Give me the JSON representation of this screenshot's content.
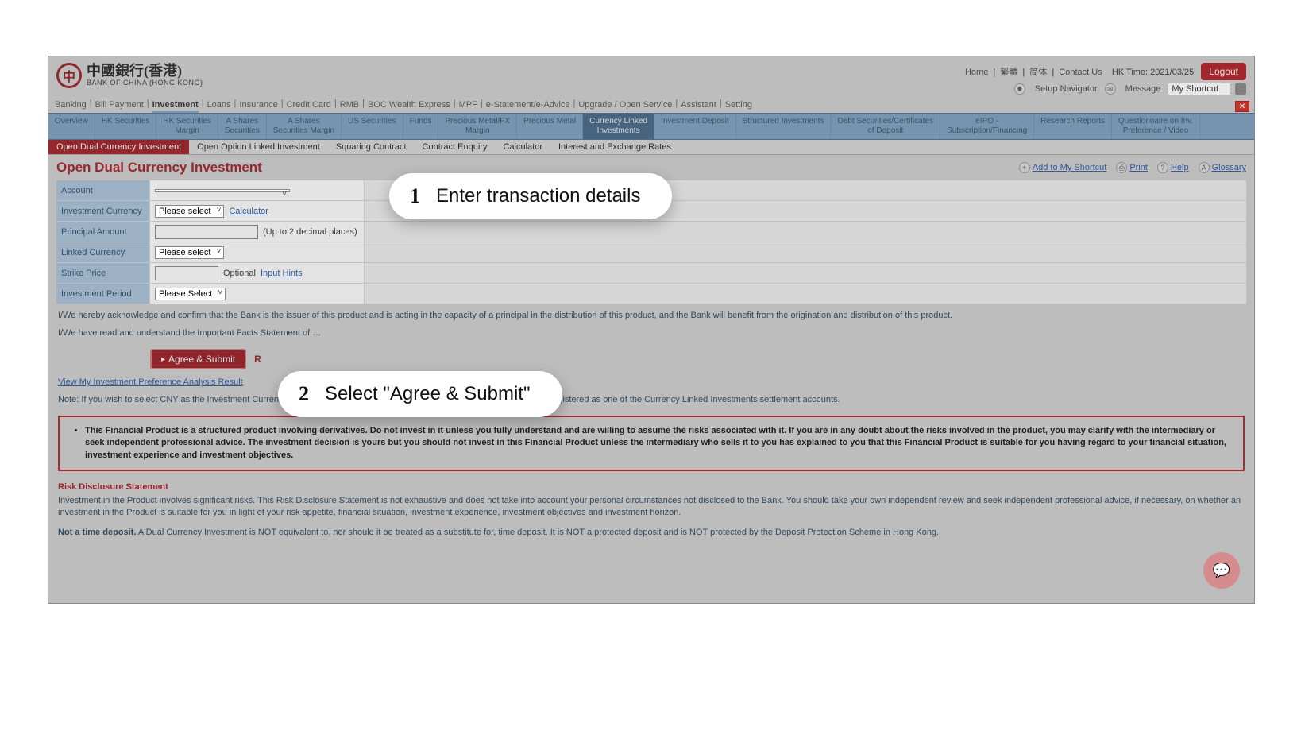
{
  "brand": {
    "cn": "中國銀行(香港)",
    "en": "BANK OF CHINA (HONG KONG)"
  },
  "top": {
    "home": "Home",
    "tc": "繁體",
    "sc": "简体",
    "contact": "Contact Us",
    "hktime_label": "HK Time:",
    "hktime_val": "2021/03/25",
    "setup_nav": "Setup Navigator",
    "message": "Message",
    "shortcut_label": "My Shortcut",
    "logout": "Logout"
  },
  "mainnav": [
    "Banking",
    "Bill Payment",
    "Investment",
    "Loans",
    "Insurance",
    "Credit Card",
    "RMB",
    "BOC Wealth Express",
    "MPF",
    "e-Statement/e-Advice",
    "Upgrade / Open Service",
    "Assistant",
    "Setting"
  ],
  "mainnav_active_index": 2,
  "subnav": [
    "Overview",
    "HK Securities",
    "HK Securities Margin",
    "A Shares Securities",
    "A Shares Securities Margin",
    "US Securities",
    "Funds",
    "Precious Metal/FX Margin",
    "Precious Metal",
    "Currency Linked Investments",
    "Investment Deposit",
    "Structured Investments",
    "Debt Securities/Certificates of Deposit",
    "eIPO - Subscription/Financing",
    "Research Reports",
    "Questionnaire on Inv. Preference / Video"
  ],
  "subnav_active_index": 9,
  "tabs": [
    "Open Dual Currency Investment",
    "Open Option Linked Investment",
    "Squaring Contract",
    "Contract Enquiry",
    "Calculator",
    "Interest and Exchange Rates"
  ],
  "tabs_active_index": 0,
  "page_title": "Open Dual Currency Investment",
  "page_tools": {
    "shortcut": "Add to My Shortcut",
    "print": "Print",
    "help": "Help",
    "glossary": "Glossary"
  },
  "form": {
    "account": {
      "label": "Account",
      "value": ""
    },
    "inv_ccy": {
      "label": "Investment Currency",
      "value": "Please select",
      "calc_link": "Calculator"
    },
    "principal": {
      "label": "Principal Amount",
      "hint": "(Up to 2 decimal places)"
    },
    "linked_ccy": {
      "label": "Linked Currency",
      "value": "Please select"
    },
    "strike": {
      "label": "Strike Price",
      "optional": "Optional",
      "hints_link": "Input Hints"
    },
    "period": {
      "label": "Investment Period",
      "value": "Please Select"
    }
  },
  "confirm": {
    "p1": "I/We hereby acknowledge and confirm that the Bank is the issuer of this product and is acting in the capacity of a principal in the distribution of this product, and the Bank will benefit from the origination and distribution of this product.",
    "p2": "I/We have read and understand the Important Facts Statement of …"
  },
  "agree_btn": "Agree & Submit",
  "reset_stub": "R",
  "pref_link": "View My Investment Preference Analysis Result",
  "note": "Note: If you wish to select CNY as the Investment Currency or the Linked Currency, an RMB account is required and it must be registered as one of the Currency Linked Investments settlement accounts.",
  "warning": "This Financial Product is a structured product involving derivatives. Do not invest in it unless you fully understand and are willing to assume the risks associated with it. If you are in any doubt about the risks involved in the product, you may clarify with the intermediary or seek independent professional advice. The investment decision is yours but you should not invest in this Financial Product unless the intermediary who sells it to you has explained to you that this Financial Product is suitable for you having regard to your financial situation, investment experience and investment objectives.",
  "risk": {
    "title": "Risk Disclosure Statement",
    "p1": "Investment in the Product involves significant risks. This Risk Disclosure Statement is not exhaustive and does not take into account your personal circumstances not disclosed to the Bank. You should take your own independent review and seek independent professional advice, if necessary, on whether an investment in the Product is suitable for you in light of your risk appetite, financial situation, investment experience, investment objectives and investment horizon.",
    "p2_bold": "Not a time deposit.",
    "p2": " A Dual Currency Investment is NOT equivalent to, nor should it be treated as a substitute for, time deposit. It is NOT a protected deposit and is NOT protected by the Deposit Protection Scheme in Hong Kong."
  },
  "callouts": {
    "c1_num": "1",
    "c1_txt": "Enter transaction details",
    "c2_num": "2",
    "c2_txt": "Select \"Agree & Submit\""
  }
}
